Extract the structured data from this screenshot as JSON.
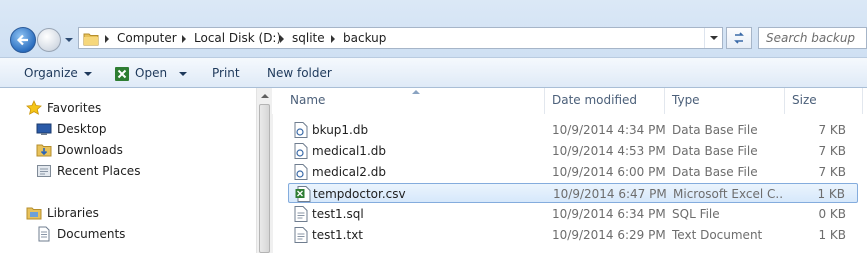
{
  "breadcrumbs": [
    "Computer",
    "Local Disk (D:)",
    "sqlite",
    "backup"
  ],
  "search": {
    "placeholder": "Search backup"
  },
  "toolbar": {
    "organize_label": "Organize",
    "open_label": "Open",
    "print_label": "Print",
    "new_folder_label": "New folder"
  },
  "nav": {
    "items": [
      {
        "label": "Favorites",
        "icon": "star-icon"
      },
      {
        "label": "Desktop",
        "icon": "desktop-icon"
      },
      {
        "label": "Downloads",
        "icon": "downloads-folder-icon"
      },
      {
        "label": "Recent Places",
        "icon": "recent-places-icon"
      },
      {
        "label": "Libraries",
        "icon": "libraries-icon"
      },
      {
        "label": "Documents",
        "icon": "documents-icon"
      }
    ]
  },
  "columns": {
    "name": "Name",
    "date": "Date modified",
    "type": "Type",
    "size": "Size"
  },
  "files": [
    {
      "name": "bkup1.db",
      "date": "10/9/2014 4:34 PM",
      "type": "Data Base File",
      "size": "7 KB",
      "icon": "db-file-icon"
    },
    {
      "name": "medical1.db",
      "date": "10/9/2014 4:53 PM",
      "type": "Data Base File",
      "size": "7 KB",
      "icon": "db-file-icon"
    },
    {
      "name": "medical2.db",
      "date": "10/9/2014 6:00 PM",
      "type": "Data Base File",
      "size": "7 KB",
      "icon": "db-file-icon"
    },
    {
      "name": "tempdoctor.csv",
      "date": "10/9/2014 6:47 PM",
      "type": "Microsoft Excel C...",
      "size": "1 KB",
      "icon": "excel-csv-icon",
      "selected": true
    },
    {
      "name": "test1.sql",
      "date": "10/9/2014 6:34 PM",
      "type": "SQL File",
      "size": "0 KB",
      "icon": "text-file-icon"
    },
    {
      "name": "test1.txt",
      "date": "10/9/2014 6:29 PM",
      "type": "Text Document",
      "size": "1 KB",
      "icon": "text-file-icon"
    }
  ]
}
